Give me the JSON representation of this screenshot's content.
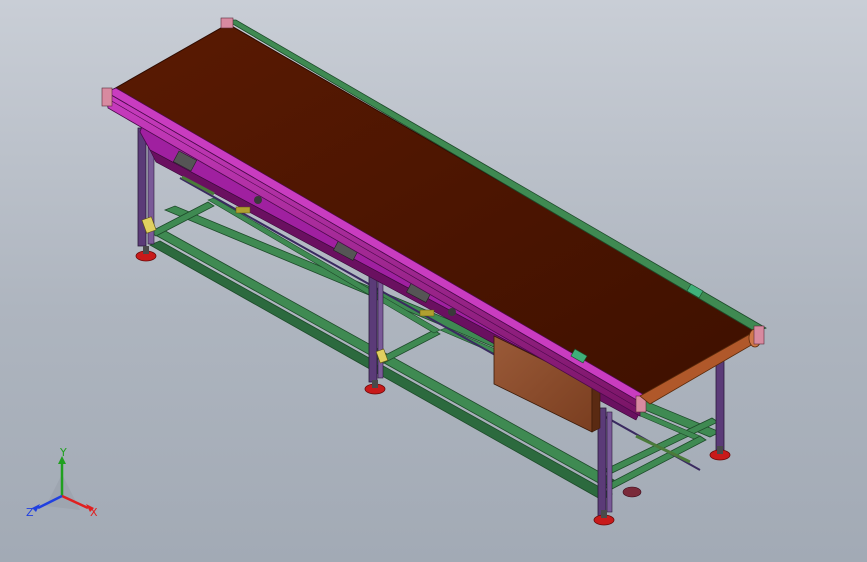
{
  "viewport": {
    "colors": {
      "background_top": "#c9ced6",
      "background_bottom": "#a2aab5",
      "belt": "#4a1500",
      "belt_edge": "#2e0b00",
      "side_rail": "#8b1a7a",
      "side_rail_light": "#c93cc0",
      "frame_green": "#3f8a52",
      "frame_green_dark": "#2c6a3e",
      "leg_purple": "#5b3b78",
      "foot_red": "#c81a1a",
      "motor_box": "#8a4a2a",
      "roller": "#b0582a"
    }
  },
  "triad": {
    "x_label": "X",
    "y_label": "Y",
    "z_label": "Z",
    "x_color": "#e02020",
    "y_color": "#20a020",
    "z_color": "#2040e0"
  }
}
